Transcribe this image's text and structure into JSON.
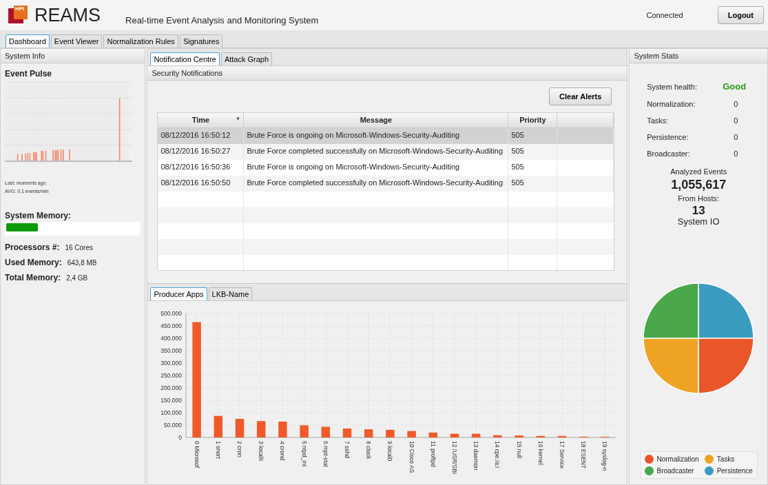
{
  "header": {
    "logo_text": "HPI",
    "app_name": "REAMS",
    "subtitle": "Real-time Event Analysis and Monitoring System",
    "connection_status": "Connected",
    "logout_button": "Logout"
  },
  "main_tabs": [
    {
      "label": "Dashboard",
      "selected": true
    },
    {
      "label": "Event Viewer",
      "selected": false
    },
    {
      "label": "Normalization Rules",
      "selected": false
    },
    {
      "label": "Signatures",
      "selected": false
    }
  ],
  "system_info": {
    "title": "System Info",
    "pulse_title": "Event Pulse",
    "last": "Last: moments ago",
    "avg": "AVG: 0.1 events/min",
    "memory_title": "System Memory:",
    "memory": {
      "level": 0.24
    },
    "facts": [
      {
        "label": "Processors #:",
        "value": "16 Cores"
      },
      {
        "label": "Used Memory:",
        "value": "643,8 MB"
      },
      {
        "label": "Total Memory:",
        "value": "2,4 GB"
      }
    ]
  },
  "center_tabs": [
    {
      "label": "Notification Centre",
      "selected": true
    },
    {
      "label": "Attack Graph",
      "selected": false
    }
  ],
  "notifications": {
    "title": "Security Notifications",
    "clear_button": "Clear Alerts",
    "columns": [
      {
        "label": "Time",
        "sort_indicator": "▼"
      },
      {
        "label": "Message"
      },
      {
        "label": "Priority"
      },
      {}
    ],
    "rows": [
      {
        "time": "08/12/2016 16:50:12",
        "message": "Brute Force is ongoing on Microsoft-Windows-Security-Auditing",
        "priority": "505",
        "selected": true
      },
      {
        "time": "08/12/2016 16:50:27",
        "message": "Brute Force completed successfully on Microsoft-Windows-Security-Auditing",
        "priority": "505",
        "selected": false
      },
      {
        "time": "08/12/2016 16:50:36",
        "message": "Brute Force is ongoing on Microsoft-Windows-Security-Auditing",
        "priority": "505",
        "selected": false
      },
      {
        "time": "08/12/2016 16:50:50",
        "message": "Brute Force completed successfully on Microsoft-Windows-Security-Auditing",
        "priority": "505",
        "selected": false
      }
    ]
  },
  "chart_tabs": [
    {
      "label": "Producer Apps",
      "selected": true
    },
    {
      "label": "LKB-Name",
      "selected": false
    }
  ],
  "producer_chart": {
    "chart_data": {
      "type": "bar",
      "categories": [
        "0 Microsof",
        "1 snort",
        "2 cron",
        "3 local6",
        "4 crond",
        "5 ntpd_int",
        "6 mpt-stat",
        "7 sshd",
        "8 clock",
        "9 local0",
        "10 Cisco AS",
        "11 proftpd",
        "12 /USR/SBI",
        "13 daemon",
        "14 cpe:/a:i",
        "15 null",
        "16 kernel",
        "17 Service",
        "18 ESENT",
        "19 syslog-n"
      ],
      "series": [
        {
          "color": "#f05a28",
          "values": [
            465,
            87,
            75,
            66,
            64,
            49,
            43,
            36,
            33,
            31,
            26,
            20,
            15,
            15,
            9,
            8,
            6,
            6,
            3,
            3
          ]
        }
      ],
      "ylim": [
        0,
        500
      ],
      "grid": true,
      "yticks": [
        {
          "value": 0,
          "label": "0"
        },
        {
          "value": 50,
          "label": "50.000"
        },
        {
          "value": 100,
          "label": "100.000"
        },
        {
          "value": 150,
          "label": "150.000"
        },
        {
          "value": 200,
          "label": "200.000"
        },
        {
          "value": 250,
          "label": "250.000"
        },
        {
          "value": 300,
          "label": "300.000"
        },
        {
          "value": 350,
          "label": "350.000"
        },
        {
          "value": 400,
          "label": "400.000"
        },
        {
          "value": 450,
          "label": "450.000"
        },
        {
          "value": 500,
          "label": "500.000"
        }
      ]
    }
  },
  "system_stats": {
    "title": "System Stats",
    "health": {
      "label": "System health:",
      "value": "Good"
    },
    "counters": [
      {
        "label": "Normalization:",
        "value": "0"
      },
      {
        "label": "Tasks:",
        "value": "0"
      },
      {
        "label": "Persistence:",
        "value": "0"
      },
      {
        "label": "Broadcaster:",
        "value": "0"
      }
    ],
    "analyzed_label": "Analyzed Events",
    "analyzed_value": "1,055,617",
    "hosts_label": "From Hosts:",
    "hosts_value": "13",
    "io_title": "System IO",
    "legend": [
      {
        "label": "Normalization",
        "color": "#e8562a"
      },
      {
        "label": "Tasks",
        "color": "#eea324"
      },
      {
        "label": "Broadcaster",
        "color": "#4aa84a"
      },
      {
        "label": "Persistence",
        "color": "#3a9dc0"
      }
    ]
  }
}
